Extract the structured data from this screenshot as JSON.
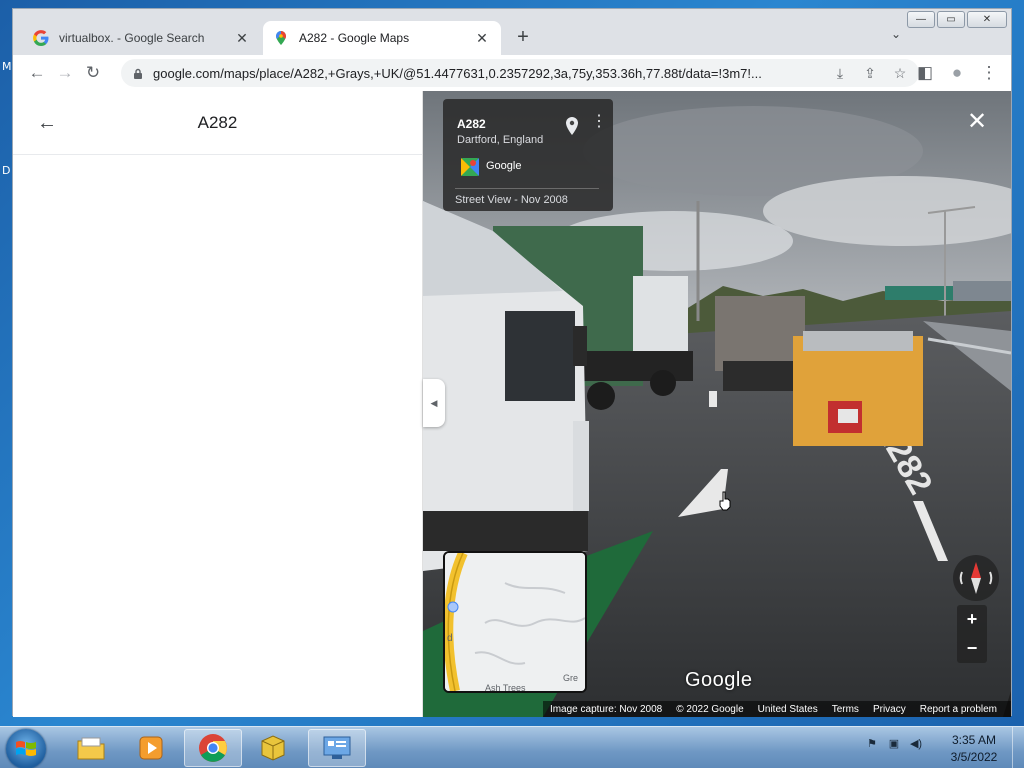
{
  "desktop": {
    "fragment_1": "M",
    "fragment_2": "D"
  },
  "window": {
    "minimize_label": "—",
    "maximize_label": "▭",
    "close_label": "✕"
  },
  "tabs": [
    {
      "title": "virtualbox. - Google Search",
      "favicon": "google-g-icon",
      "active": false
    },
    {
      "title": "A282 - Google Maps",
      "favicon": "google-maps-pin-icon",
      "active": true
    }
  ],
  "tab_close_glyph": "✕",
  "new_tab_glyph": "+",
  "tab_search_glyph": "⌄",
  "address_bar": {
    "url": "google.com/maps/place/A282,+Grays,+UK/@51.4477631,0.2357292,3a,75y,353.36h,77.88t/data=!3m7!..."
  },
  "toolbar_icons": {
    "back": "←",
    "forward": "→",
    "reload": "↻",
    "install": "⤓",
    "share": "⇪",
    "bookmark": "☆",
    "sidepanel": "◧",
    "profile": "●",
    "menu": "⋮"
  },
  "side_panel": {
    "back_glyph": "←",
    "title": "A282",
    "collapse_glyph": "◀"
  },
  "street_view": {
    "road": "A282",
    "place": "Dartford, England",
    "provider": "Google",
    "more_glyph": "⋮",
    "capture_label": "Street View - Nov 2008",
    "close_glyph": "✕",
    "watermark": "Google",
    "zoom_in": "+",
    "zoom_out": "−",
    "attribution": {
      "image_capture": "Image capture: Nov 2008",
      "copyright": "© 2022 Google",
      "region": "United States",
      "terms": "Terms",
      "privacy": "Privacy",
      "report": "Report a problem"
    },
    "minimap": {
      "label_left": "d",
      "label_right": "Gre",
      "label_bottom": "Ash Trees"
    }
  },
  "taskbar": {
    "apps": [
      "file-explorer-icon",
      "media-player-icon",
      "chrome-icon",
      "virtualbox-icon",
      "control-panel-icon"
    ],
    "clock_time": "3:35 AM",
    "clock_date": "3/5/2022"
  },
  "colors": {
    "chrome_tabstrip": "#dee1e6",
    "omnibox": "#f1f3f4",
    "overlay": "#282828",
    "road_yellow": "#f2c12e",
    "taskbar": "#6f98c4"
  }
}
